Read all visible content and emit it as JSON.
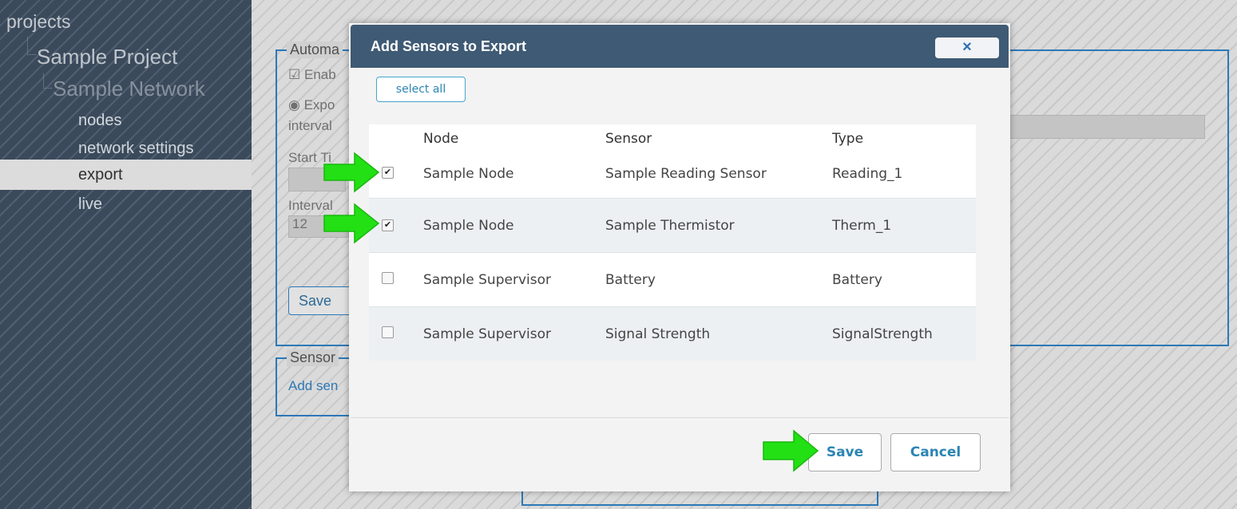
{
  "sidebar": {
    "tree": {
      "root": "projects",
      "project": "Sample Project",
      "network": "Sample Network",
      "items": [
        "nodes",
        "network settings",
        "export",
        "live"
      ],
      "selected": "export"
    }
  },
  "background": {
    "automated_legend": "Automa",
    "enable_label": "Enab",
    "export_label": "Expo",
    "interval_word": "interval",
    "start_time_label": "Start Ti",
    "interval_label": "Interval",
    "interval_value": "12",
    "save_button": "Save",
    "sensor_legend": "Sensor",
    "add_sensor_link": "Add sen"
  },
  "modal": {
    "title": "Add Sensors to Export",
    "close_glyph": "×",
    "select_all": "select all",
    "columns": [
      "Node",
      "Sensor",
      "Type"
    ],
    "rows": [
      {
        "checked": true,
        "node": "Sample Node",
        "sensor": "Sample Reading Sensor",
        "type": "Reading_1",
        "highlighted": true
      },
      {
        "checked": true,
        "node": "Sample Node",
        "sensor": "Sample Thermistor",
        "type": "Therm_1",
        "highlighted": true
      },
      {
        "checked": false,
        "node": "Sample Supervisor",
        "sensor": "Battery",
        "type": "Battery",
        "highlighted": false
      },
      {
        "checked": false,
        "node": "Sample Supervisor",
        "sensor": "Signal Strength",
        "type": "SignalStrength",
        "highlighted": false
      }
    ],
    "save": "Save",
    "cancel": "Cancel"
  },
  "colors": {
    "accent": "#2f7fc1",
    "header": "#3f5a74",
    "arrow": "#22e014"
  }
}
